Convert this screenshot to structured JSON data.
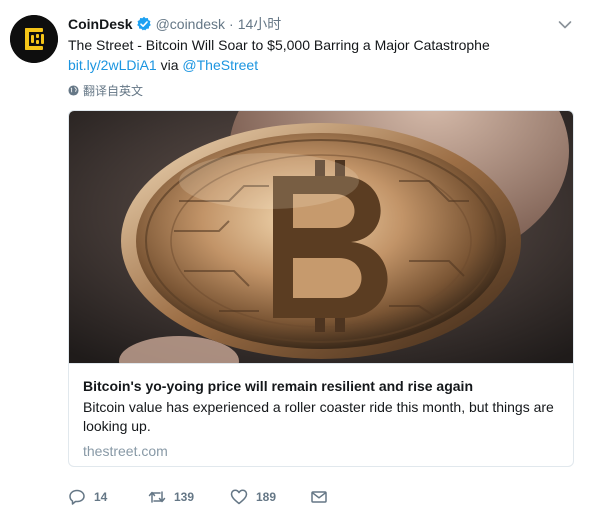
{
  "tweet": {
    "author_name": "CoinDesk",
    "author_handle": "@coindesk",
    "separator": "·",
    "timestamp": "14小时",
    "text_line1": "The Street - Bitcoin Will Soar to $5,000 Barring a Major Catastrophe",
    "short_link": "bit.ly/2wLDiA1",
    "via_label": "via",
    "via_handle": "@TheStreet",
    "translate_label": "翻译自英文"
  },
  "card": {
    "title": "Bitcoin's yo-yoing price will remain resilient and rise again",
    "description": "Bitcoin value has experienced a roller coaster ride this month, but things are looking up.",
    "domain": "thestreet.com"
  },
  "actions": {
    "reply_count": "14",
    "retweet_count": "139",
    "like_count": "189"
  },
  "icons": {
    "avatar": "coindesk-logo-icon",
    "verified": "verified-badge-icon",
    "caret": "chevron-down-icon",
    "translate": "globe-icon",
    "reply": "reply-icon",
    "retweet": "retweet-icon",
    "like": "heart-icon",
    "dm": "envelope-icon"
  },
  "colors": {
    "link": "#1b95e0",
    "secondary_text": "#657786",
    "verified": "#1da1f2",
    "card_border": "#e1e8ed",
    "logo_yellow": "#f5c518"
  }
}
